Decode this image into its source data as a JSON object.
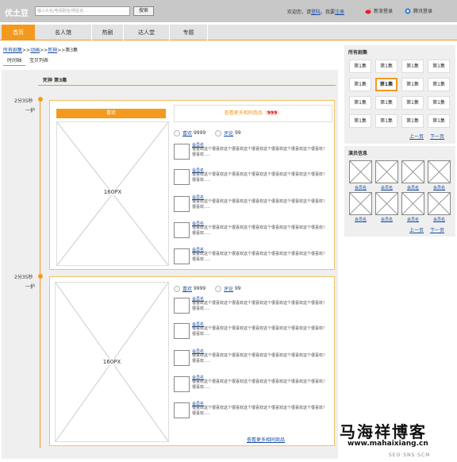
{
  "header": {
    "logo": "优土豆",
    "search_placeholder": "输入片名/电视剧名/明星名...",
    "search_button": "搜索",
    "welcome_prefix": "欢迎您，请",
    "login_link": "登陆",
    "welcome_mid": "，我要",
    "register_link": "注册",
    "weibo_login": "新浪登录",
    "tencent_login": "腾讯登录"
  },
  "nav": {
    "tabs": [
      "首页",
      "名人馆",
      "热剧",
      "达人堂",
      "专题"
    ],
    "active": "首页"
  },
  "breadcrumb": {
    "all": "所有剧集",
    "sep": ">>",
    "cat": "动画",
    "show": "死神",
    "ep": "第3集"
  },
  "subtabs": [
    "时间轴",
    "宝贝列表"
  ],
  "episode": {
    "title": "死神 第3集"
  },
  "timeline": {
    "entries": [
      {
        "time": "2分35秒",
        "label": "一护",
        "like_label": "喜欢",
        "image_label": "160PX",
        "more_prefix": "查看更多相同商品（",
        "more_count": "999",
        "more_suffix": "）",
        "like_count_label": "喜欢",
        "like_count": "9999",
        "comment_label": "评论",
        "comment_count": "99",
        "comments": [
          {
            "name": "会员名",
            "text": "很喜欢这个很喜欢这个很喜欢这个很喜欢这个很喜欢这个很喜欢这个很喜欢！很喜欢....."
          },
          {
            "name": "会员名",
            "text": "很喜欢这个很喜欢这个很喜欢这个很喜欢这个很喜欢这个很喜欢这个很喜欢！很喜欢....."
          },
          {
            "name": "会员名",
            "text": "很喜欢这个很喜欢这个很喜欢这个很喜欢这个很喜欢这个很喜欢这个很喜欢！很喜欢....."
          },
          {
            "name": "会员名",
            "text": "很喜欢这个很喜欢这个很喜欢这个很喜欢这个很喜欢这个很喜欢这个很喜欢！很喜欢....."
          },
          {
            "name": "会员名",
            "text": "很喜欢这个很喜欢这个很喜欢这个很喜欢这个很喜欢这个很喜欢这个很喜欢！很喜欢....."
          }
        ]
      },
      {
        "time": "2分35秒",
        "label": "一护",
        "image_label": "160PX",
        "like_count_label": "喜欢",
        "like_count": "9999",
        "comment_label": "评论",
        "comment_count": "99",
        "more_link": "查看更多相同商品",
        "comments": [
          {
            "name": "会员名",
            "text": "很喜欢这个很喜欢这个很喜欢这个很喜欢这个很喜欢这个很喜欢这个很喜欢！很喜欢....."
          },
          {
            "name": "会员名",
            "text": "很喜欢这个很喜欢这个很喜欢这个很喜欢这个很喜欢这个很喜欢这个很喜欢！很喜欢....."
          },
          {
            "name": "会员名",
            "text": "很喜欢这个很喜欢这个很喜欢这个很喜欢这个很喜欢这个很喜欢这个很喜欢！很喜欢....."
          },
          {
            "name": "会员名",
            "text": "很喜欢这个很喜欢这个很喜欢这个很喜欢这个很喜欢这个很喜欢这个很喜欢！很喜欢....."
          },
          {
            "name": "会员名",
            "text": "很喜欢这个很喜欢这个很喜欢这个很喜欢这个很喜欢这个很喜欢这个很喜欢！很喜欢....."
          }
        ]
      }
    ]
  },
  "sidebar": {
    "episodes_title": "所有剧集",
    "episode_label": "第1集",
    "current_index": 5,
    "prev": "上一页",
    "next": "下一页",
    "cast_title": "演员信息",
    "cast_name": "会员名"
  },
  "watermark": {
    "name": "马海祥博客",
    "url": "www.mahaixiang.cn",
    "sub": "SEO·SNS·SCM"
  },
  "colors": {
    "accent": "#f39a1e",
    "link": "#1a4fa3",
    "count_red": "#d40000"
  }
}
